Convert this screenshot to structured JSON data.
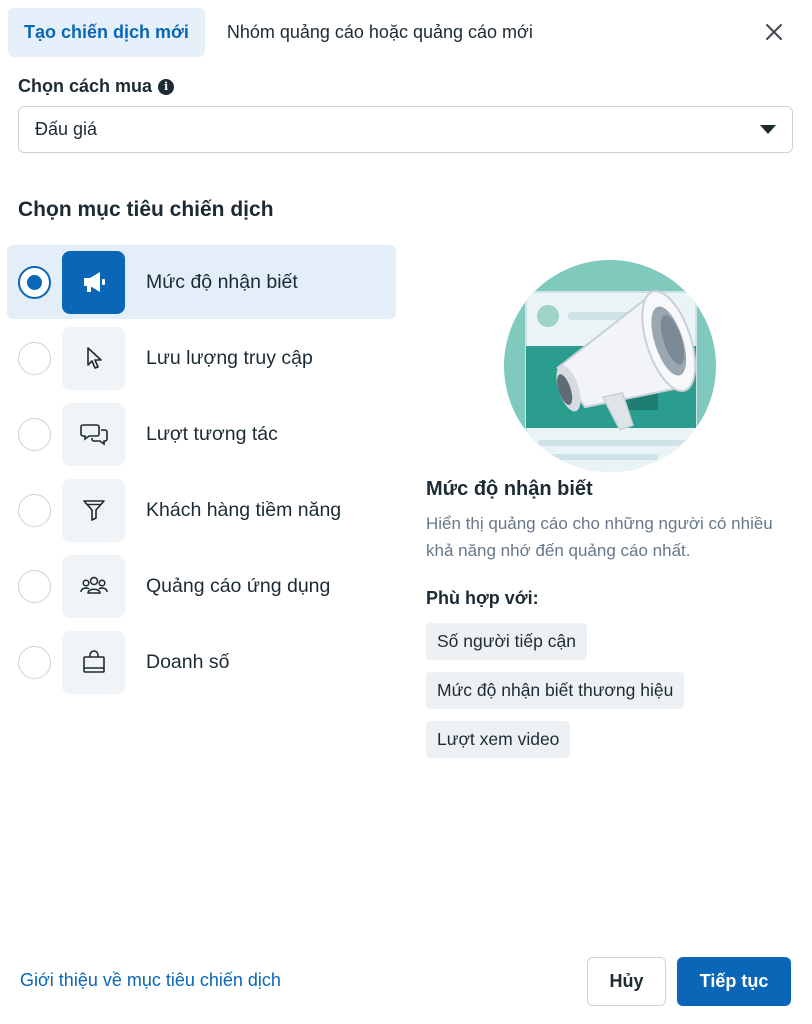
{
  "tabs": [
    {
      "label": "Tạo chiến dịch mới",
      "active": true
    },
    {
      "label": "Nhóm quảng cáo hoặc quảng cáo mới",
      "active": false
    }
  ],
  "buying": {
    "label": "Chọn cách mua",
    "info_icon": "info-icon",
    "selected_value": "Đấu giá"
  },
  "objective_section": {
    "title": "Chọn mục tiêu chiến dịch",
    "items": [
      {
        "label": "Mức độ nhận biết",
        "icon": "megaphone-icon",
        "selected": true
      },
      {
        "label": "Lưu lượng truy cập",
        "icon": "cursor-icon",
        "selected": false
      },
      {
        "label": "Lượt tương tác",
        "icon": "chat-bubbles-icon",
        "selected": false
      },
      {
        "label": "Khách hàng tiềm năng",
        "icon": "filter-icon",
        "selected": false
      },
      {
        "label": "Quảng cáo ứng dụng",
        "icon": "people-icon",
        "selected": false
      },
      {
        "label": "Doanh số",
        "icon": "shopping-bag-icon",
        "selected": false
      }
    ]
  },
  "detail": {
    "title": "Mức độ nhận biết",
    "description": "Hiển thị quảng cáo cho những người có nhiều khả năng nhớ đến quảng cáo nhất.",
    "fit_label": "Phù hợp với:",
    "chips": [
      "Số người tiếp cận",
      "Mức độ nhận biết thương hiệu",
      "Lượt xem video"
    ]
  },
  "footer": {
    "link": "Giới thiệu về mục tiêu chiến dịch",
    "cancel": "Hủy",
    "next": "Tiếp tục"
  },
  "colors": {
    "accent": "#0a66b7",
    "selected_bg": "#e3eef8",
    "text": "#1c2b33",
    "muted": "#67788a",
    "illustration_teal": "#2a9d8f"
  }
}
